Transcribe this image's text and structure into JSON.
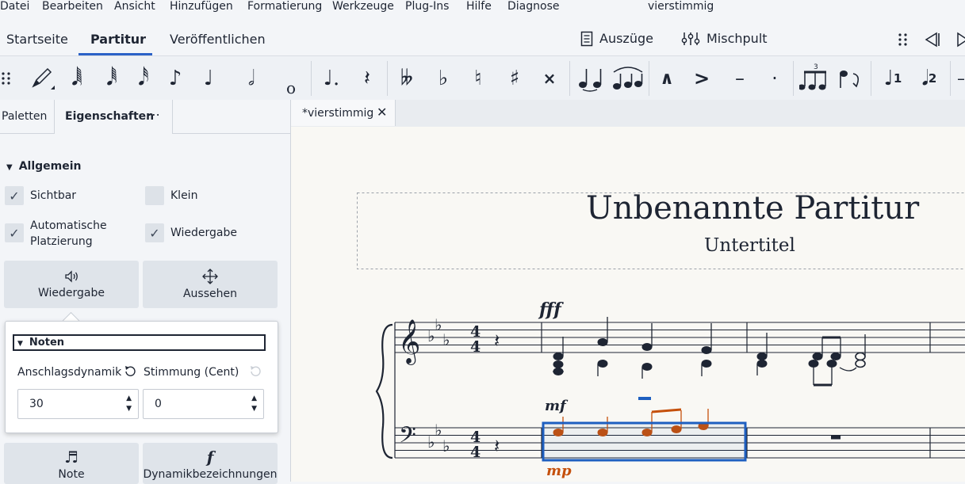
{
  "menu": [
    "Datei",
    "Bearbeiten",
    "Ansicht",
    "Hinzufügen",
    "Formatierung",
    "Werkzeuge",
    "Plug-Ins",
    "Hilfe",
    "Diagnose"
  ],
  "window_title": "vierstimmig",
  "nav": {
    "tabs": [
      "Startseite",
      "Partitur",
      "Veröffentlichen"
    ],
    "active": "Partitur",
    "parts_label": "Auszüge",
    "mixer_label": "Mischpult"
  },
  "toolbar": {
    "icons": [
      "grip-icon",
      "pencil-icon",
      "note-64th-icon",
      "note-32nd-icon",
      "note-16th-icon",
      "note-eighth-icon",
      "note-quarter-icon",
      "note-half-icon",
      "note-whole-icon",
      "dotted-note-icon",
      "rest-icon",
      "double-flat-icon",
      "flat-icon",
      "natural-icon",
      "sharp-icon",
      "double-sharp-icon",
      "tie-icon",
      "slur-icon",
      "marcato-icon",
      "accent-icon",
      "tenuto-icon",
      "staccato-icon",
      "tuplet-icon",
      "flip-icon",
      "voice-1-icon",
      "voice-2-icon"
    ],
    "voice1": "1",
    "voice2": "2",
    "tuplet_number": "3"
  },
  "panel": {
    "tabs": [
      "Paletten",
      "Eigenschaften"
    ],
    "active_tab": "Eigenschaften",
    "more": "⋯",
    "section": "Allgemein",
    "checkboxes": [
      {
        "label": "Sichtbar",
        "checked": true
      },
      {
        "label": "Klein",
        "checked": false
      },
      {
        "label": "Automatische Platzierung",
        "checked": true
      },
      {
        "label": "Wiedergabe",
        "checked": true
      }
    ],
    "buttons": [
      {
        "label": "Wiedergabe",
        "icon": "speaker-icon"
      },
      {
        "label": "Aussehen",
        "icon": "move-icon"
      },
      {
        "label": "Note",
        "icon": "note-icon"
      },
      {
        "label": "Dynamikbezeichnungen",
        "icon": "forte-icon"
      }
    ],
    "popup": {
      "title": "Noten",
      "velocity_label": "Anschlagsdynamik",
      "tuning_label": "Stimmung (Cent)",
      "velocity_value": "30",
      "tuning_value": "0"
    }
  },
  "document": {
    "tab_label": "*vierstimmig",
    "title": "Unbenannte Partitur",
    "subtitle": "Untertitel",
    "dynamics": [
      "fff",
      "mf",
      "mp"
    ]
  },
  "colors": {
    "accent": "#2b62c7",
    "selection": "#1e5fc0",
    "selected_notes": "#c5500c",
    "page": "#f9f8f4"
  }
}
